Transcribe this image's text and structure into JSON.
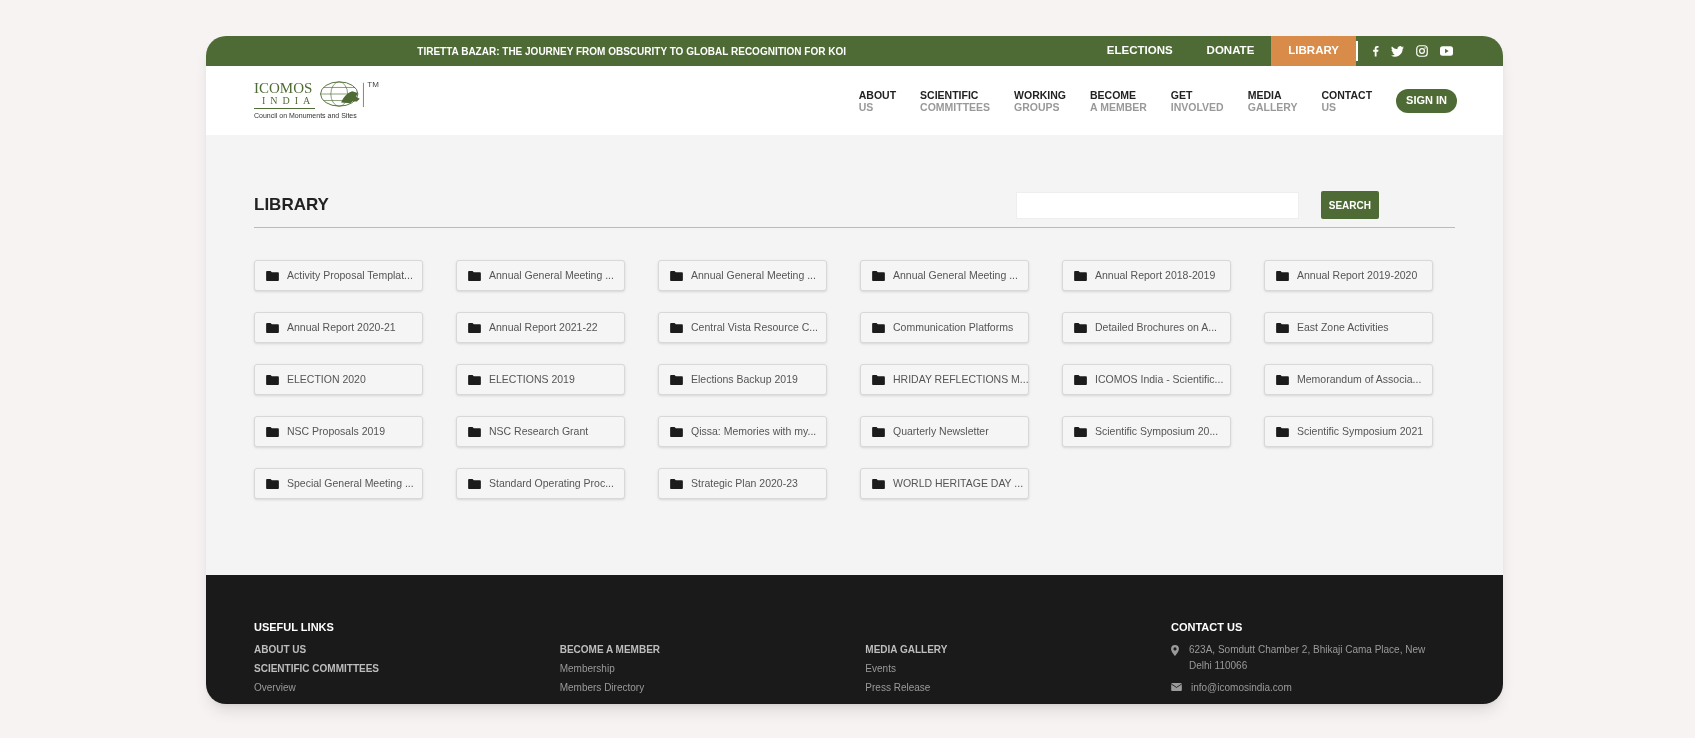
{
  "top_bar": {
    "headline": "TIRETTA BAZAR: THE JOURNEY FROM OBSCURITY TO GLOBAL RECOGNITION FOR KOI",
    "links": [
      {
        "label": "ELECTIONS",
        "selected": false
      },
      {
        "label": "DONATE",
        "selected": false
      },
      {
        "label": "LIBRARY",
        "selected": true
      }
    ]
  },
  "logo": {
    "word_1": "ICOMOS",
    "word_2": "INDIA",
    "trademark": "TM",
    "tagline": "Council on Monuments and Sites"
  },
  "nav": [
    {
      "line_1": "ABOUT",
      "line_2": "US"
    },
    {
      "line_1": "SCIENTIFIC",
      "line_2": "COMMITTEES"
    },
    {
      "line_1": "WORKING",
      "line_2": "GROUPS"
    },
    {
      "line_1": "BECOME",
      "line_2": "A MEMBER"
    },
    {
      "line_1": "GET",
      "line_2": "INVOLVED"
    },
    {
      "line_1": "MEDIA",
      "line_2": "GALLERY"
    },
    {
      "line_1": "CONTACT",
      "line_2": "US"
    }
  ],
  "sign_in": "SIGN IN",
  "library": {
    "title": "LIBRARY",
    "search_button": "SEARCH",
    "folders": [
      "Activity Proposal Templat...",
      "Annual General Meeting ...",
      "Annual General Meeting ...",
      "Annual General Meeting ...",
      "Annual Report 2018-2019",
      "Annual Report 2019-2020",
      "Annual Report 2020-21",
      "Annual Report 2021-22",
      "Central Vista Resource C...",
      "Communication Platforms",
      "Detailed Brochures on A...",
      "East Zone Activities",
      "ELECTION 2020",
      "ELECTIONS 2019",
      "Elections Backup 2019",
      "HRIDAY REFLECTIONS M...",
      "ICOMOS India - Scientific...",
      "Memorandum of Associa...",
      "NSC Proposals 2019",
      "NSC Research Grant",
      "Qissa: Memories with my...",
      "Quarterly Newsletter",
      "Scientific Symposium 20...",
      "Scientific Symposium 2021",
      "Special General Meeting ...",
      "Standard Operating Proc...",
      "Strategic Plan 2020-23",
      "WORLD HERITAGE DAY ..."
    ]
  },
  "footer": {
    "useful_links_title": "USEFUL LINKS",
    "columns": [
      [
        {
          "kind": "heading",
          "text": "ABOUT US"
        },
        {
          "kind": "heading",
          "text": "SCIENTIFIC COMMITTEES"
        },
        {
          "kind": "link",
          "text": "Overview"
        }
      ],
      [
        {
          "kind": "heading",
          "text": "BECOME A MEMBER"
        },
        {
          "kind": "link",
          "text": "Membership"
        },
        {
          "kind": "link",
          "text": "Members Directory"
        }
      ],
      [
        {
          "kind": "heading",
          "text": "MEDIA GALLERY"
        },
        {
          "kind": "link",
          "text": "Events"
        },
        {
          "kind": "link",
          "text": "Press Release"
        }
      ]
    ],
    "contact": {
      "title": "CONTACT US",
      "address": "623A, Somdutt Chamber 2, Bhikaji Cama Place, New Delhi 110066",
      "email": "info@icomosindia.com"
    }
  }
}
